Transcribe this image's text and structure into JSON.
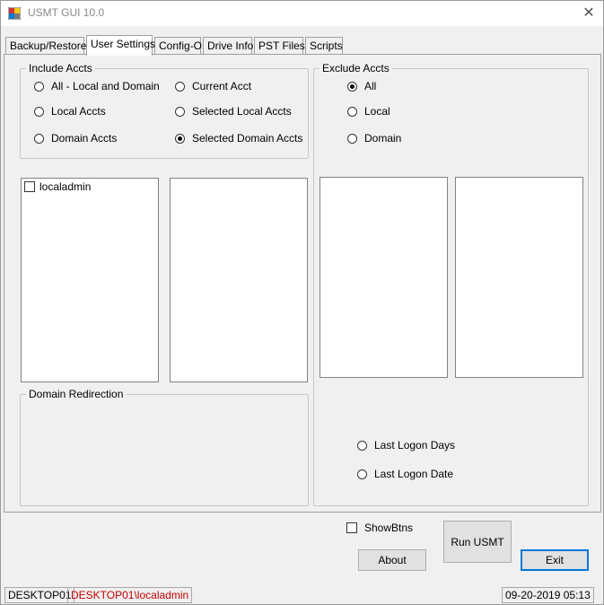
{
  "window": {
    "title": "USMT GUI 10.0",
    "close_icon": "close-icon"
  },
  "tabs": [
    {
      "label": "Backup/Restore"
    },
    {
      "label": "User Settings",
      "active": true
    },
    {
      "label": "Config-O"
    },
    {
      "label": "Drive Info"
    },
    {
      "label": "PST Files"
    },
    {
      "label": "Scripts"
    }
  ],
  "include": {
    "legend": "Include Accts",
    "options": [
      {
        "label": "All - Local and Domain",
        "checked": false
      },
      {
        "label": "Current Acct",
        "checked": false
      },
      {
        "label": "Local Accts",
        "checked": false
      },
      {
        "label": "Selected Local Accts",
        "checked": false
      },
      {
        "label": "Domain Accts",
        "checked": false
      },
      {
        "label": "Selected Domain Accts",
        "checked": true
      }
    ]
  },
  "include_list": {
    "items": [
      {
        "label": "localadmin",
        "checked": false
      }
    ]
  },
  "domain_redirection": {
    "legend": "Domain Redirection"
  },
  "exclude": {
    "legend": "Exclude Accts",
    "options": [
      {
        "label": "All",
        "checked": true
      },
      {
        "label": "Local",
        "checked": false
      },
      {
        "label": "Domain",
        "checked": false
      }
    ],
    "logon_options": [
      {
        "label": "Last Logon Days",
        "checked": false
      },
      {
        "label": "Last Logon Date",
        "checked": false
      }
    ]
  },
  "bottom": {
    "showbtns_label": "ShowBtns",
    "run_label": "Run USMT",
    "about_label": "About",
    "exit_label": "Exit"
  },
  "status": {
    "computer": "DESKTOP01",
    "user": "DESKTOP01\\localadmin",
    "datetime": "09-20-2019 05:13"
  }
}
